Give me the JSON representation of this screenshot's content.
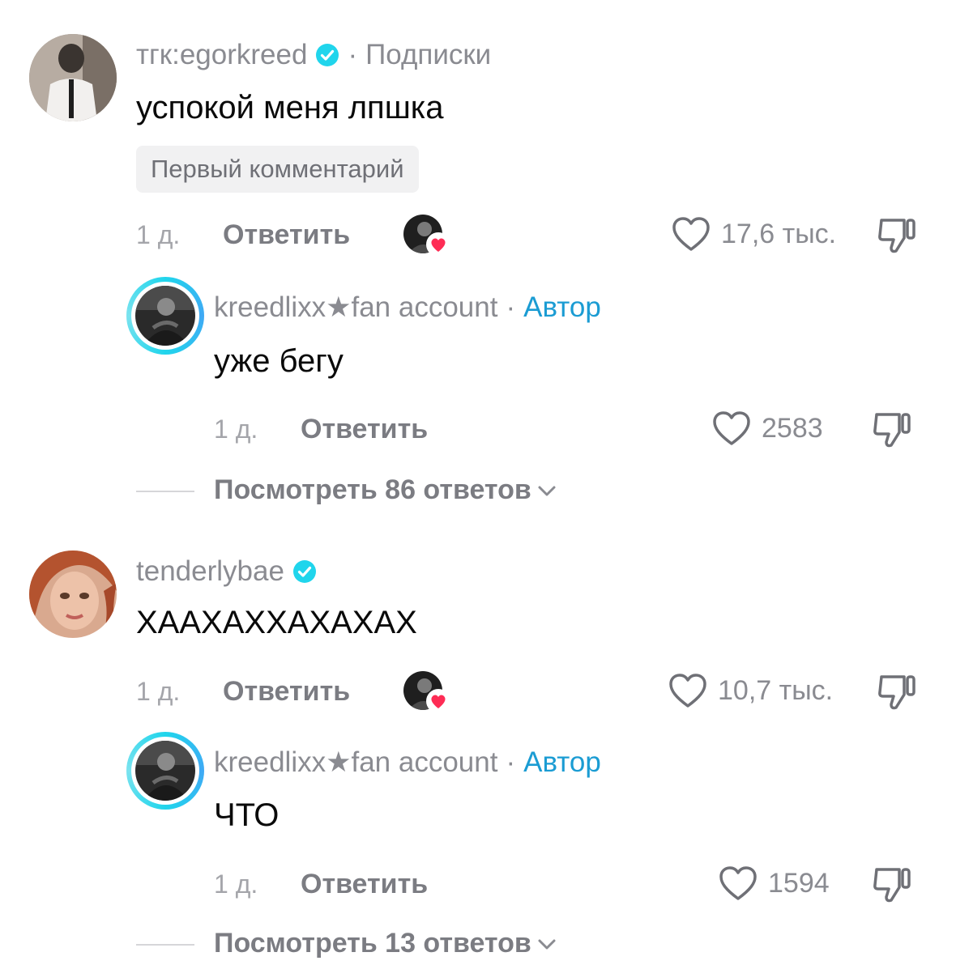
{
  "comments": [
    {
      "username": "тгк:egorkreed",
      "verified": true,
      "relation": "Подписки",
      "text": "успокой меня лпшка",
      "badge": "Первый комментарий",
      "time": "1 д.",
      "reply_label": "Ответить",
      "likes": "17,6 тыс.",
      "creator_liked": true,
      "replies": [
        {
          "username": "kreedlixx★fan account",
          "role": "Автор",
          "text": "уже бегу",
          "time": "1 д.",
          "reply_label": "Ответить",
          "likes": "2583"
        }
      ],
      "view_more": "Посмотреть 86 ответов"
    },
    {
      "username": "tenderlybae",
      "verified": true,
      "text": "ХААХАХХАХАХАХ",
      "time": "1 д.",
      "reply_label": "Ответить",
      "likes": "10,7 тыс.",
      "creator_liked": true,
      "replies": [
        {
          "username": "kreedlixx★fan account",
          "role": "Автор",
          "text": "ЧТО",
          "time": "1 д.",
          "reply_label": "Ответить",
          "likes": "1594"
        }
      ],
      "view_more": "Посмотреть 13 ответов"
    }
  ],
  "separator": "·",
  "colors": {
    "verified": "#20d5ec",
    "author": "#1b9cd3",
    "creator_heart": "#fe2c55",
    "muted_text": "#8a8b91"
  },
  "icons": [
    "verified-check-icon",
    "heart-outline-icon",
    "thumbs-down-icon",
    "chevron-down-icon",
    "creator-heart-icon"
  ]
}
